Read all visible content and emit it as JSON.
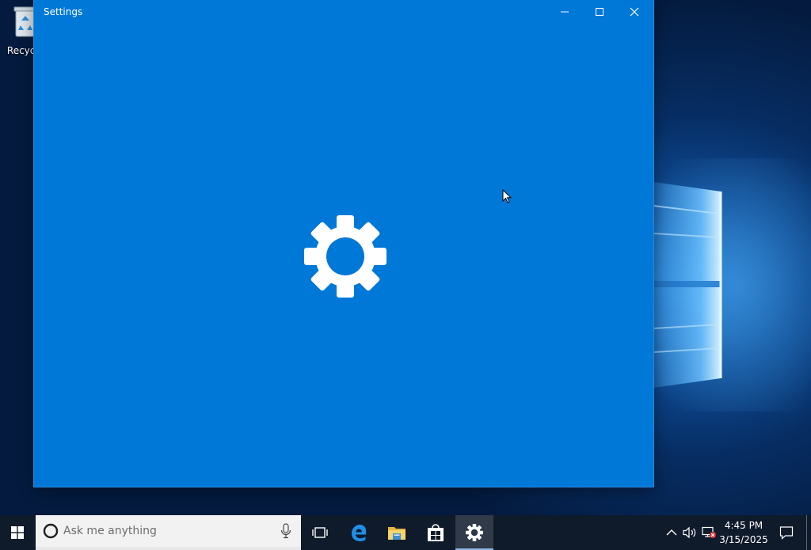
{
  "desktop": {
    "icons": [
      {
        "label": "Recycle",
        "icon": "recycle-bin-icon"
      }
    ]
  },
  "window": {
    "title": "Settings",
    "controls": {
      "minimize": "minimize-icon",
      "maximize": "maximize-icon",
      "close": "close-icon"
    },
    "background": "#0078d7",
    "splash_icon": "gear-icon"
  },
  "taskbar": {
    "start_icon": "windows-logo-icon",
    "search": {
      "placeholder": "Ask me anything",
      "value": "",
      "icons": [
        "cortana-icon",
        "microphone-icon"
      ]
    },
    "apps": [
      {
        "name": "Task View",
        "icon": "task-view-icon",
        "active": false
      },
      {
        "name": "Microsoft Edge",
        "icon": "edge-icon",
        "active": false
      },
      {
        "name": "File Explorer",
        "icon": "folder-icon",
        "active": false
      },
      {
        "name": "Store",
        "icon": "store-icon",
        "active": false
      },
      {
        "name": "Settings",
        "icon": "gear-icon",
        "active": true
      }
    ],
    "tray": {
      "icons": [
        "chevron-up-icon",
        "speaker-icon",
        "network-disconnected-icon",
        "notification-icon"
      ],
      "time": "4:45 PM",
      "date": "3/15/2025"
    }
  }
}
